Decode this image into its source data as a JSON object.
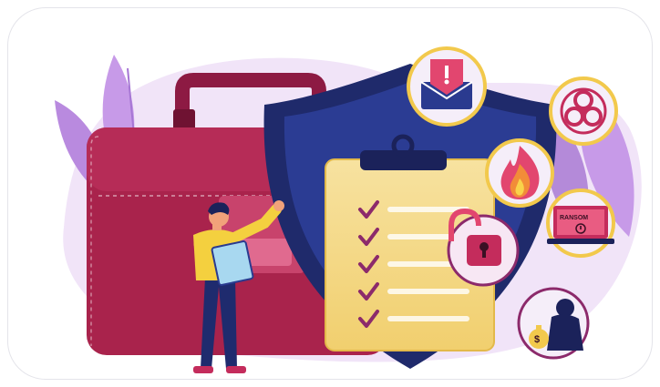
{
  "illustration": {
    "subject": "business-risk-management",
    "icons": [
      "briefcase-icon",
      "shield-icon",
      "clipboard-checklist-icon",
      "warning-envelope-icon",
      "biohazard-icon",
      "fire-icon",
      "open-padlock-icon",
      "ransomware-laptop-icon",
      "thief-icon"
    ],
    "laptop_screen_text": "RANSOM",
    "checklist_count": 5
  },
  "colors": {
    "briefcase": "#b0264f",
    "briefcase_dark": "#7d1437",
    "shield_outer": "#1f2b6e",
    "shield_inner": "#2a3a8f",
    "clipboard": "#f6dc8a",
    "checkmark": "#8a2d6a",
    "leaves": "#c89be6",
    "blob": "#efe1f7",
    "icon_ring": "#f2c94c",
    "person_shirt": "#f4d03f",
    "person_pants": "#1f2b6e",
    "person_skin": "#f2a27a"
  }
}
